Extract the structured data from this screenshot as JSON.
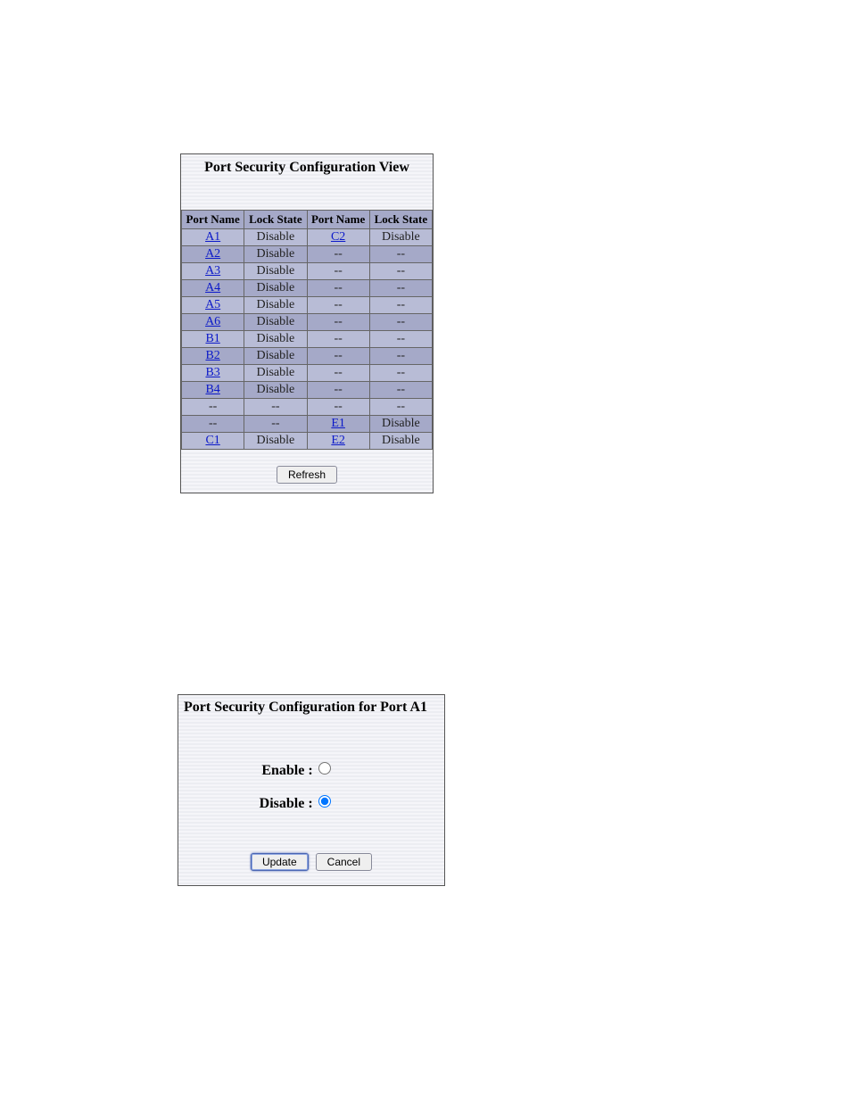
{
  "view": {
    "title": "Port Security Configuration View",
    "headers": {
      "port_name_a": "Port Name",
      "lock_state_a": "Lock State",
      "port_name_b": "Port Name",
      "lock_state_b": "Lock State"
    },
    "rows": [
      {
        "p1": "A1",
        "s1": "Disable",
        "p2": "C2",
        "s2": "Disable",
        "l1": true,
        "l2": true
      },
      {
        "p1": "A2",
        "s1": "Disable",
        "p2": "--",
        "s2": "--",
        "l1": true,
        "l2": false
      },
      {
        "p1": "A3",
        "s1": "Disable",
        "p2": "--",
        "s2": "--",
        "l1": true,
        "l2": false
      },
      {
        "p1": "A4",
        "s1": "Disable",
        "p2": "--",
        "s2": "--",
        "l1": true,
        "l2": false
      },
      {
        "p1": "A5",
        "s1": "Disable",
        "p2": "--",
        "s2": "--",
        "l1": true,
        "l2": false
      },
      {
        "p1": "A6",
        "s1": "Disable",
        "p2": "--",
        "s2": "--",
        "l1": true,
        "l2": false
      },
      {
        "p1": "B1",
        "s1": "Disable",
        "p2": "--",
        "s2": "--",
        "l1": true,
        "l2": false
      },
      {
        "p1": "B2",
        "s1": "Disable",
        "p2": "--",
        "s2": "--",
        "l1": true,
        "l2": false
      },
      {
        "p1": "B3",
        "s1": "Disable",
        "p2": "--",
        "s2": "--",
        "l1": true,
        "l2": false
      },
      {
        "p1": "B4",
        "s1": "Disable",
        "p2": "--",
        "s2": "--",
        "l1": true,
        "l2": false
      },
      {
        "p1": "--",
        "s1": "--",
        "p2": "--",
        "s2": "--",
        "l1": false,
        "l2": false
      },
      {
        "p1": "--",
        "s1": "--",
        "p2": "E1",
        "s2": "Disable",
        "l1": false,
        "l2": true
      },
      {
        "p1": "C1",
        "s1": "Disable",
        "p2": "E2",
        "s2": "Disable",
        "l1": true,
        "l2": true
      }
    ],
    "refresh_label": "Refresh"
  },
  "config": {
    "title": "Port Security Configuration for Port A1",
    "enable_label": "Enable",
    "disable_label": "Disable",
    "selected": "disable",
    "update_label": "Update",
    "cancel_label": "Cancel"
  }
}
